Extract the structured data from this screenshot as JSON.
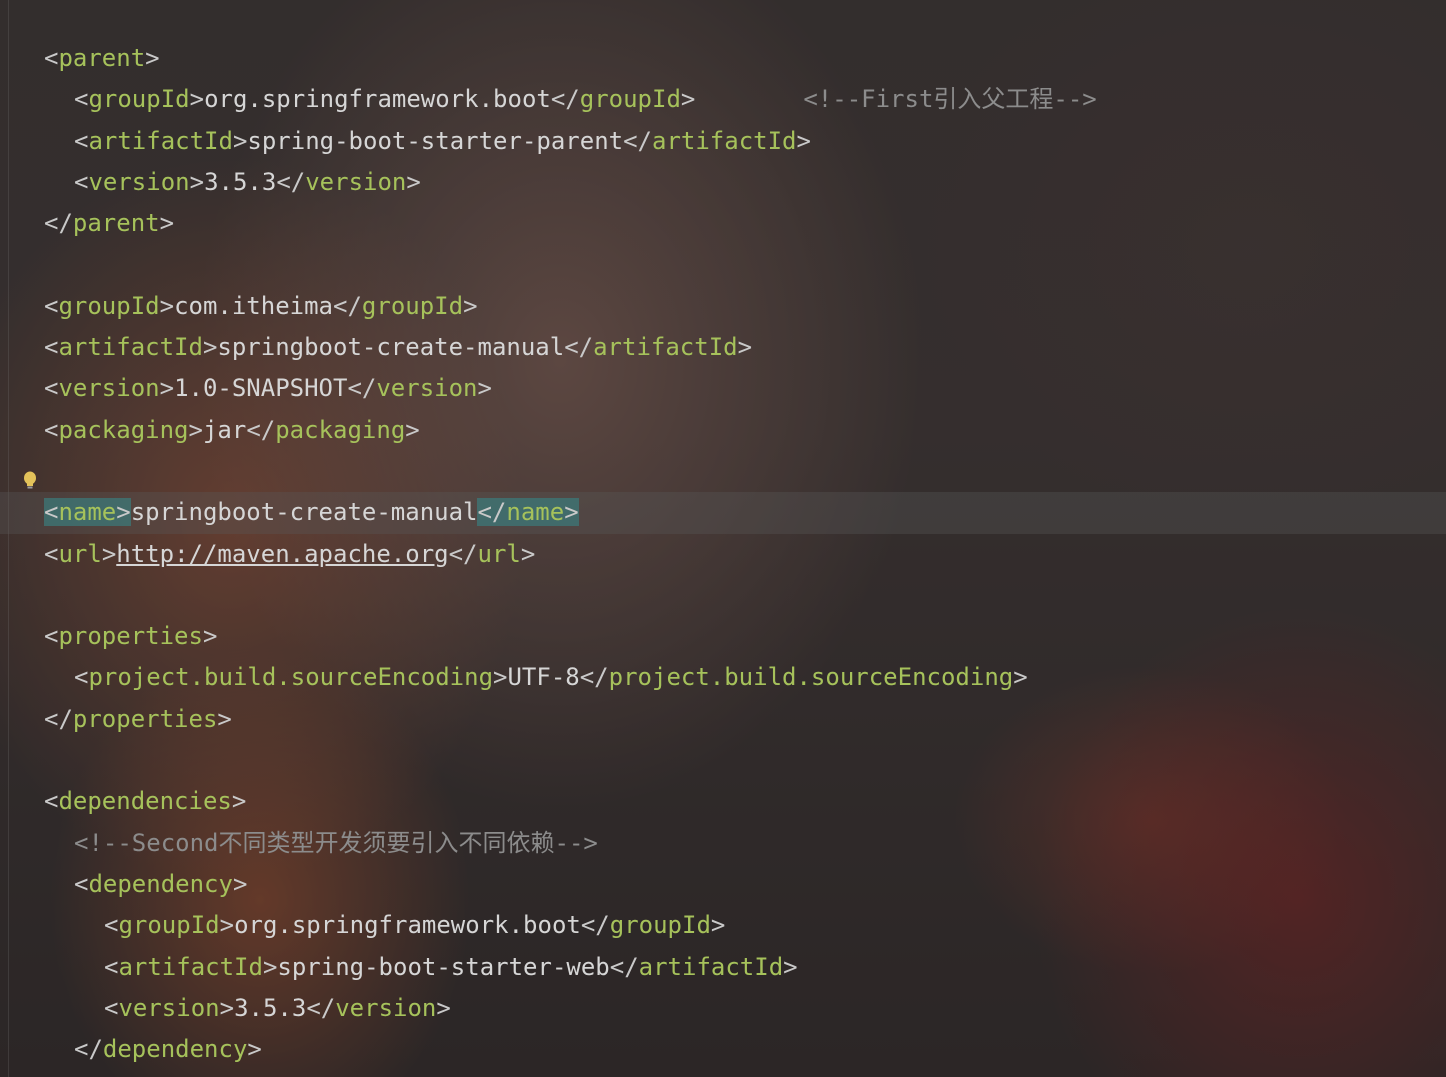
{
  "editor": {
    "lines": [
      {
        "indent": 0,
        "open": "parent",
        "text": "",
        "close": "",
        "comment": ""
      },
      {
        "indent": 1,
        "open": "groupId",
        "text": "org.springframework.boot",
        "close": "groupId",
        "comment": "<!--First引入父工程-->"
      },
      {
        "indent": 1,
        "open": "artifactId",
        "text": "spring-boot-starter-parent",
        "close": "artifactId",
        "comment": ""
      },
      {
        "indent": 1,
        "open": "version",
        "text": "3.5.3",
        "close": "version",
        "comment": ""
      },
      {
        "indent": 0,
        "open": "",
        "text": "",
        "close": "parent",
        "comment": ""
      },
      {
        "blank": true
      },
      {
        "indent": 0,
        "open": "groupId",
        "text": "com.itheima",
        "close": "groupId",
        "comment": ""
      },
      {
        "indent": 0,
        "open": "artifactId",
        "text": "springboot-create-manual",
        "close": "artifactId",
        "comment": ""
      },
      {
        "indent": 0,
        "open": "version",
        "text": "1.0-SNAPSHOT",
        "close": "version",
        "comment": ""
      },
      {
        "indent": 0,
        "open": "packaging",
        "text": "jar",
        "close": "packaging",
        "comment": ""
      },
      {
        "blank": true
      },
      {
        "indent": 0,
        "open": "name",
        "text": "springboot-create-manual",
        "close": "name",
        "comment": "",
        "current": true
      },
      {
        "indent": 0,
        "open": "url",
        "text": "http://maven.apache.org",
        "close": "url",
        "comment": "",
        "link": true
      },
      {
        "blank": true
      },
      {
        "indent": 0,
        "open": "properties",
        "text": "",
        "close": "",
        "comment": ""
      },
      {
        "indent": 1,
        "open": "project.build.sourceEncoding",
        "text": "UTF-8",
        "close": "project.build.sourceEncoding",
        "comment": ""
      },
      {
        "indent": 0,
        "open": "",
        "text": "",
        "close": "properties",
        "comment": ""
      },
      {
        "blank": true
      },
      {
        "indent": 0,
        "open": "dependencies",
        "text": "",
        "close": "",
        "comment": ""
      },
      {
        "indent": 1,
        "open": "",
        "text": "",
        "close": "",
        "comment": "<!--Second不同类型开发须要引入不同依赖-->"
      },
      {
        "indent": 1,
        "open": "dependency",
        "text": "",
        "close": "",
        "comment": ""
      },
      {
        "indent": 2,
        "open": "groupId",
        "text": "org.springframework.boot",
        "close": "groupId",
        "comment": ""
      },
      {
        "indent": 2,
        "open": "artifactId",
        "text": "spring-boot-starter-web",
        "close": "artifactId",
        "comment": ""
      },
      {
        "indent": 2,
        "open": "version",
        "text": "3.5.3",
        "close": "version",
        "comment": ""
      },
      {
        "indent": 1,
        "open": "",
        "text": "",
        "close": "dependency",
        "comment": ""
      }
    ],
    "gutter_icons": [
      "lightbulb-icon"
    ]
  }
}
